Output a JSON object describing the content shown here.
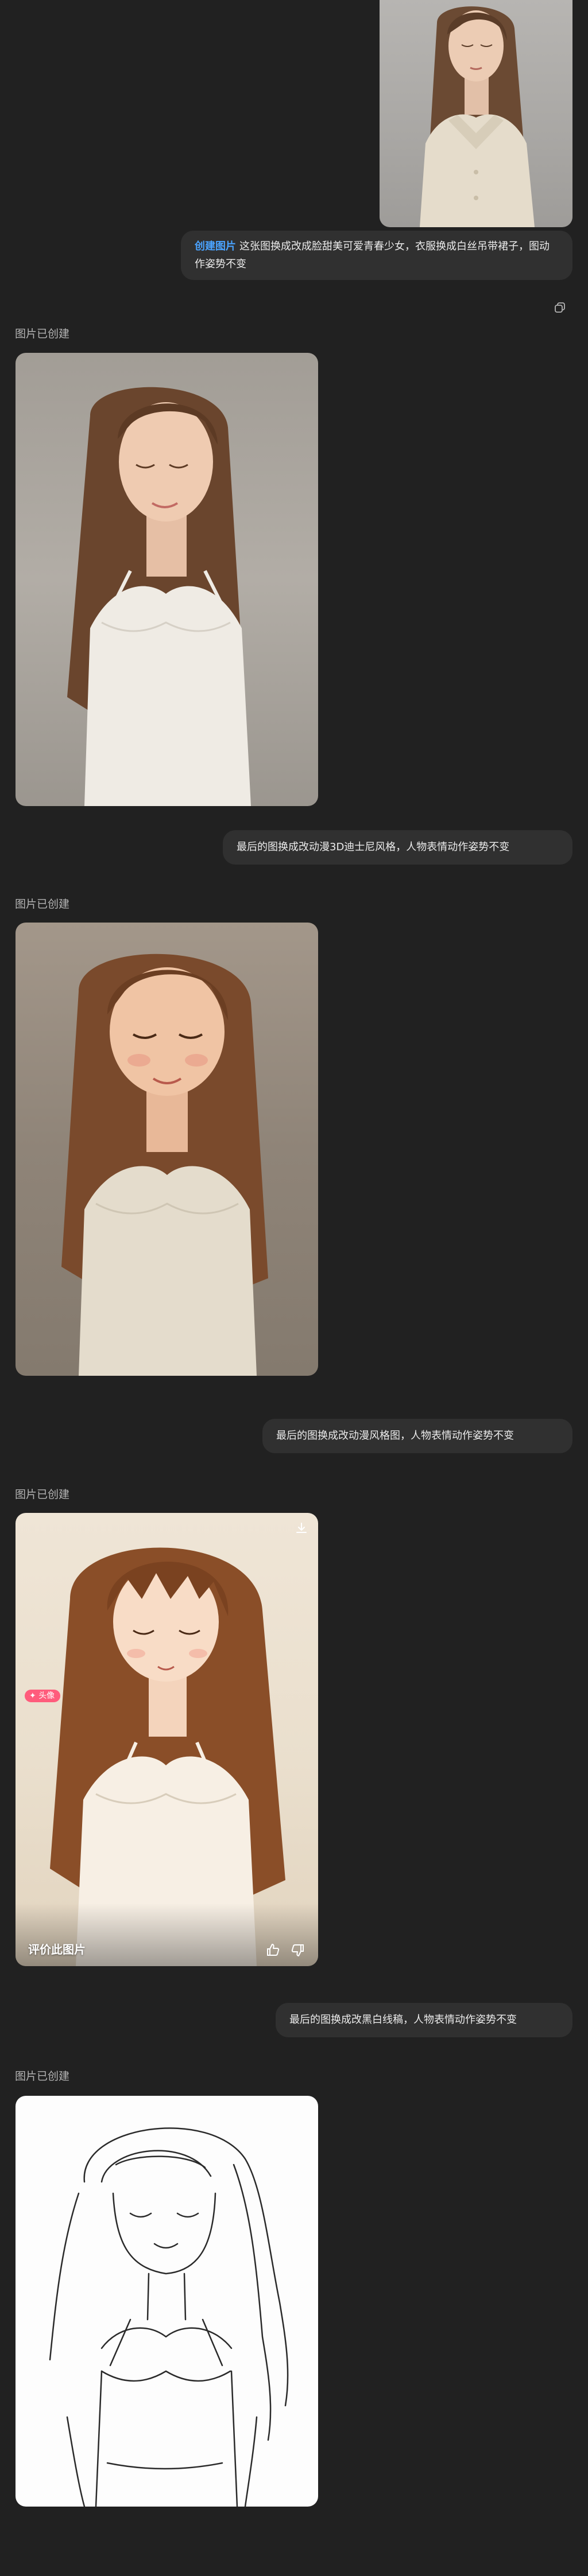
{
  "messages": {
    "user_1": {
      "tag": "创建图片",
      "text": "这张图换成改成脸甜美可爱青春少女，衣服换成白丝吊带裙子，图动作姿势不变"
    },
    "assistant_1": {
      "label": "图片已创建"
    },
    "user_2": {
      "text": "最后的图换成改动漫3D迪士尼风格，人物表情动作姿势不变"
    },
    "assistant_2": {
      "label": "图片已创建"
    },
    "user_3": {
      "text": "最后的图换成改动漫风格图，人物表情动作姿势不变"
    },
    "assistant_3": {
      "label": "图片已创建",
      "badge": "头像",
      "rate_label": "评价此图片"
    },
    "user_4": {
      "text": "最后的图换成改黑白线稿，人物表情动作姿势不变"
    },
    "assistant_4": {
      "label": "图片已创建"
    }
  },
  "icons": {
    "copy": "copy-icon",
    "download": "download-icon",
    "thumbs_up": "thumbs-up-icon",
    "thumbs_down": "thumbs-down-icon"
  },
  "colors": {
    "background": "#212121",
    "bubble": "#303030",
    "accent": "#4aa3ff",
    "badge": "#ff5c7c"
  }
}
